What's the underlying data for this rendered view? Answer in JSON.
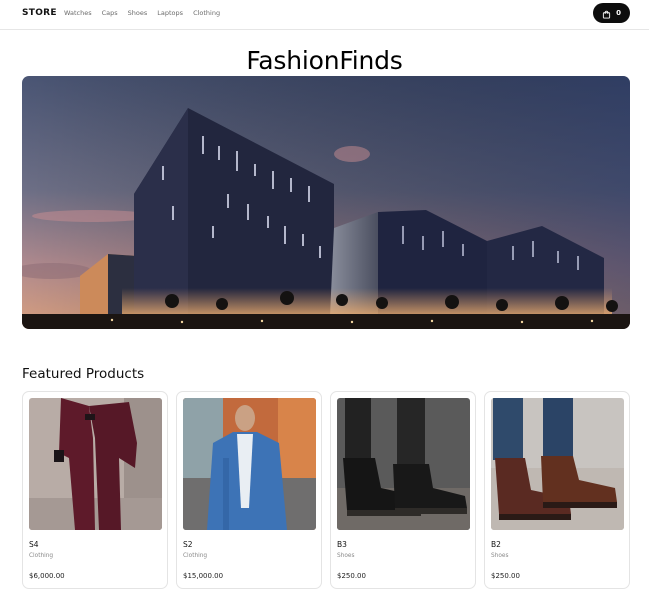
{
  "navbar": {
    "logo": "STORE",
    "links": [
      "Watches",
      "Caps",
      "Shoes",
      "Laptops",
      "Clothing"
    ],
    "cart_count": "0",
    "cart_icon": "shopping-bag-icon"
  },
  "hero": {
    "title": "FashionFinds",
    "image": "shopping-mall-building-at-dusk"
  },
  "featured": {
    "title": "Featured Products",
    "products": [
      {
        "name": "S4",
        "category": "Clothing",
        "price": "$6,000.00",
        "image": "man-in-burgundy-suit"
      },
      {
        "name": "S2",
        "category": "Clothing",
        "price": "$15,000.00",
        "image": "man-in-blue-blazer"
      },
      {
        "name": "B3",
        "category": "Shoes",
        "price": "$250.00",
        "image": "black-leather-boots"
      },
      {
        "name": "B2",
        "category": "Shoes",
        "price": "$250.00",
        "image": "brown-leather-boots"
      }
    ]
  }
}
